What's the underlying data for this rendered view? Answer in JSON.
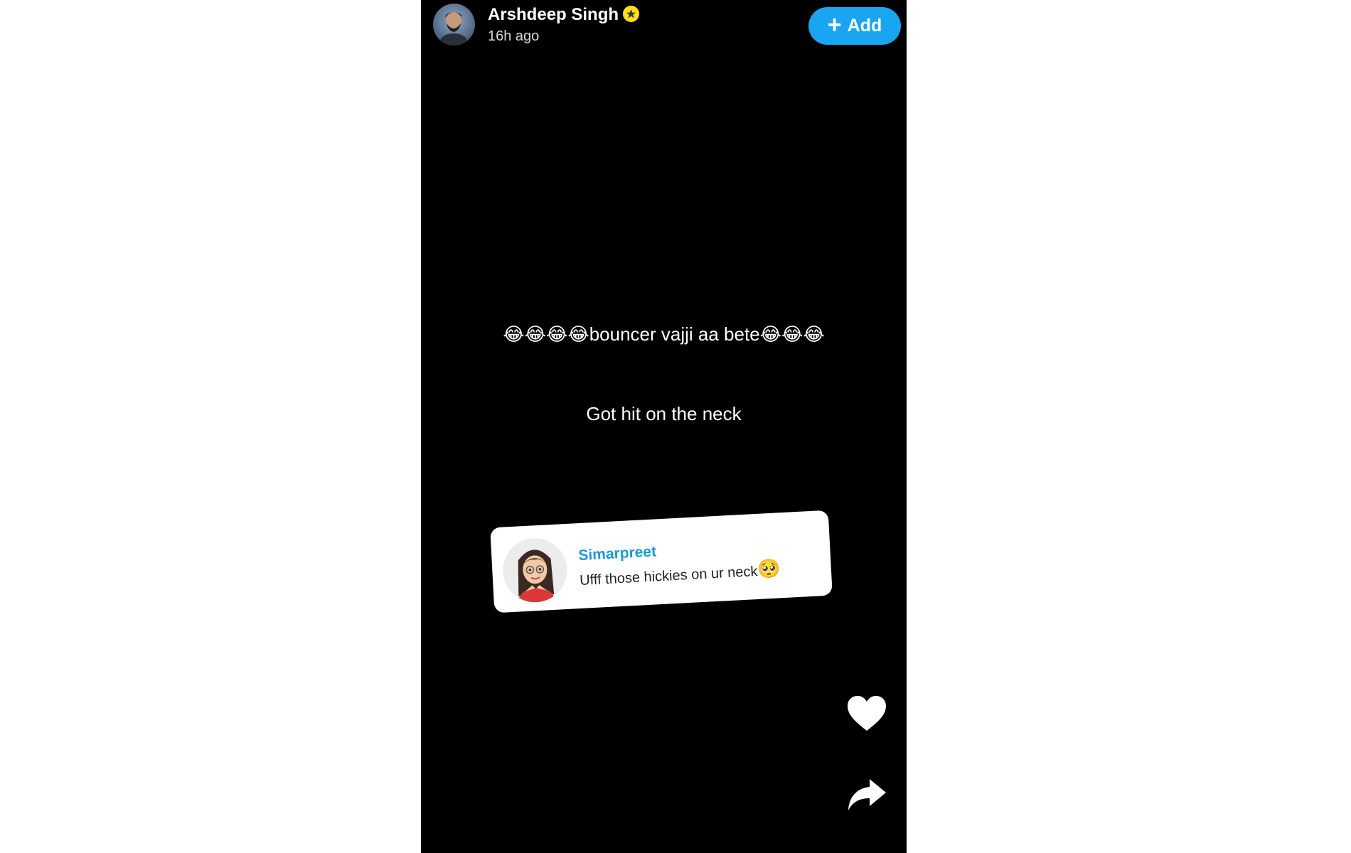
{
  "header": {
    "username": "Arshdeep Singh",
    "timestamp": "16h ago",
    "add_label": "Add",
    "verified_icon": "star-badge-icon",
    "accent_color": "#1aa5f0"
  },
  "story": {
    "caption_emojis_before": "😂😂😂😂",
    "caption_text": "bouncer vajji aa bete",
    "caption_emojis_after": "😂😂😂",
    "subcaption": "Got hit on the neck"
  },
  "reply_sticker": {
    "name": "Simarpreet",
    "message": "Ufff those hickies on ur neck",
    "message_emoji": "🥺",
    "name_color": "#1a9ad6"
  },
  "actions": {
    "like_icon": "heart-icon",
    "share_icon": "share-arrow-icon"
  }
}
